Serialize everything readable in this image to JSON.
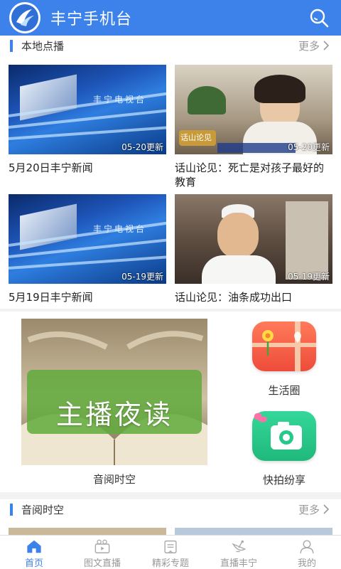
{
  "header": {
    "title": "丰宁手机台"
  },
  "local_section": {
    "title": "本地点播",
    "more_label": "更多",
    "cards": [
      {
        "title": "5月20日丰宁新闻",
        "date_tag": "05-20更新",
        "thumb": "news-studio",
        "brand": "丰宁电视台"
      },
      {
        "title": "话山论见：死亡是对孩子最好的教育",
        "date_tag": "05-20更新",
        "thumb": "woman-interview",
        "brand": "话山论见"
      },
      {
        "title": "5月19日丰宁新闻",
        "date_tag": "05-19更新",
        "thumb": "news-studio",
        "brand": "丰宁电视台"
      },
      {
        "title": "话山论见：油条成功出口",
        "date_tag": "05-19更新",
        "thumb": "chef-interview",
        "brand": ""
      }
    ]
  },
  "feature": {
    "banner_text": "主播夜读",
    "banner_caption": "音阅时空",
    "tiles": [
      {
        "label": "生活圈",
        "icon": "gift-box-icon",
        "color": "#f0603c"
      },
      {
        "label": "快拍纷享",
        "icon": "camera-icon",
        "color": "#27c98a"
      }
    ]
  },
  "audio_section": {
    "title": "音阅时空",
    "more_label": "更多"
  },
  "tabbar": {
    "items": [
      {
        "label": "首页",
        "icon": "home-icon",
        "active": true
      },
      {
        "label": "图文直播",
        "icon": "video-icon",
        "active": false
      },
      {
        "label": "精彩专题",
        "icon": "book-icon",
        "active": false
      },
      {
        "label": "直播丰宁",
        "icon": "satellite-icon",
        "active": false
      },
      {
        "label": "我的",
        "icon": "user-icon",
        "active": false
      }
    ]
  },
  "colors": {
    "primary": "#3d82ea",
    "text": "#222222",
    "muted": "#999999"
  }
}
